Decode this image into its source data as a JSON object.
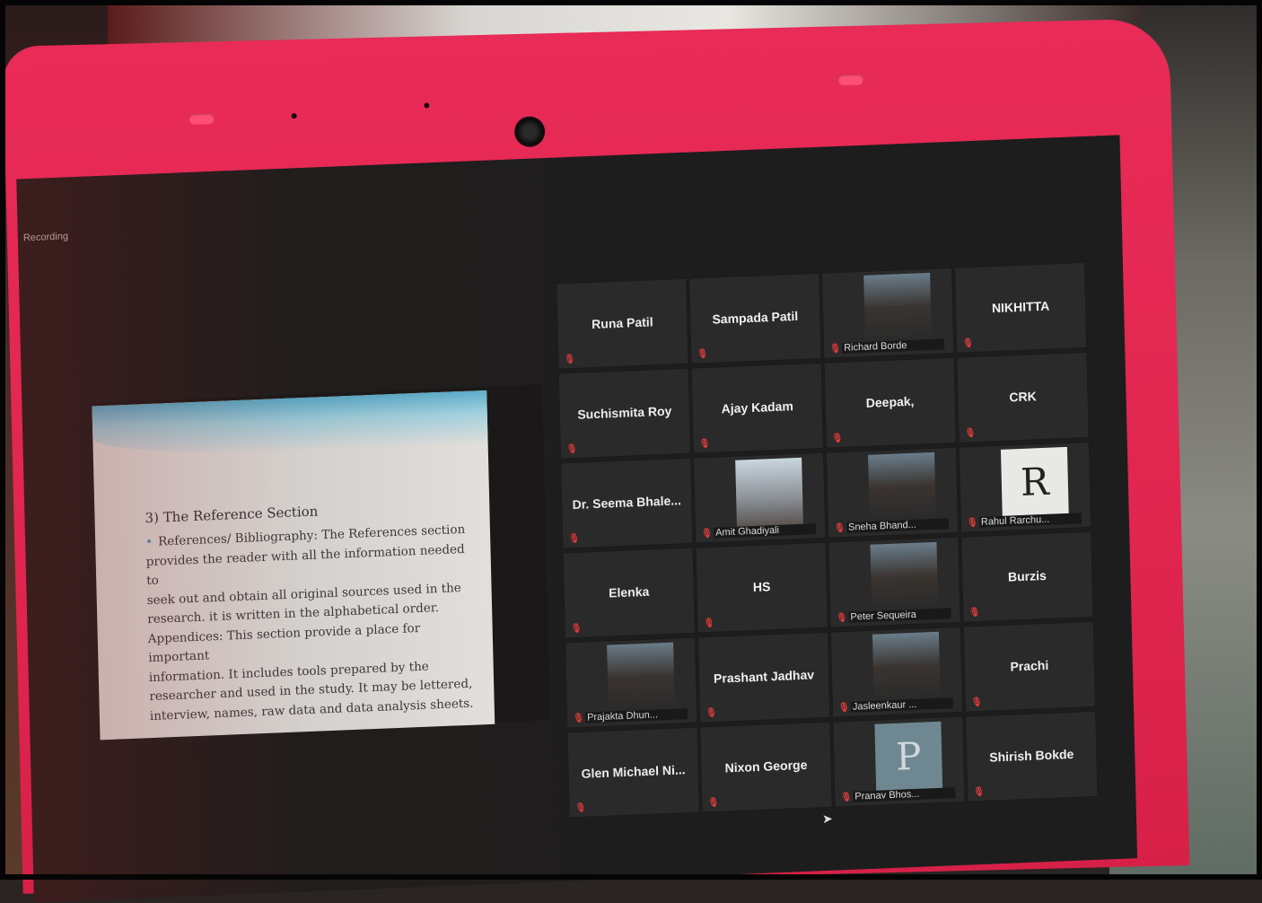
{
  "recording_label": "Recording",
  "slide": {
    "heading": "3) The Reference Section",
    "lines": [
      "References/ Bibliography: The References section",
      "provides the reader with all the information needed to",
      "seek out and obtain all original sources  used in the",
      "research. it is written in the alphabetical order.",
      "Appendices: This section provide a place for important",
      "information. It includes tools prepared by the",
      "researcher and used in the study. It may be lettered,",
      "interview, names, raw data and data analysis sheets."
    ]
  },
  "participants": [
    {
      "name": "Runa Patil",
      "video": false
    },
    {
      "name": "Sampada Patil",
      "video": false
    },
    {
      "name": "Richard Borde",
      "video": true
    },
    {
      "name": "NIKHITTA",
      "video": false
    },
    {
      "name": "Suchismita Roy",
      "video": false
    },
    {
      "name": "Ajay Kadam",
      "video": false
    },
    {
      "name": "Deepak,",
      "video": false
    },
    {
      "name": "CRK",
      "video": false
    },
    {
      "name": "Dr. Seema Bhale...",
      "video": false
    },
    {
      "name": "Amit Ghadiyali",
      "video": true
    },
    {
      "name": "Sneha Bhand...",
      "video": true
    },
    {
      "name": "Rahul Rarchu...",
      "video": true,
      "letter": "R"
    },
    {
      "name": "Elenka",
      "video": false
    },
    {
      "name": "HS",
      "video": false
    },
    {
      "name": "Peter Sequeira",
      "video": true
    },
    {
      "name": "Burzis",
      "video": false
    },
    {
      "name": "Prajakta Dhun...",
      "video": true
    },
    {
      "name": "Prashant Jadhav",
      "video": false
    },
    {
      "name": "Jasleenkaur ...",
      "video": true
    },
    {
      "name": "Prachi",
      "video": false
    },
    {
      "name": "Glen Michael Ni...",
      "video": false
    },
    {
      "name": "Nixon George",
      "video": false
    },
    {
      "name": "Pranav Bhos...",
      "video": true,
      "letter": "P"
    },
    {
      "name": "Shirish Bokde",
      "video": false
    }
  ],
  "colors": {
    "bezel": "#e0264f",
    "muted_icon": "#e23a3a",
    "tile_bg": "#2a2a2a"
  },
  "icons": {
    "muted": "muted-mic-icon",
    "cursor": "mouse-cursor-icon"
  }
}
